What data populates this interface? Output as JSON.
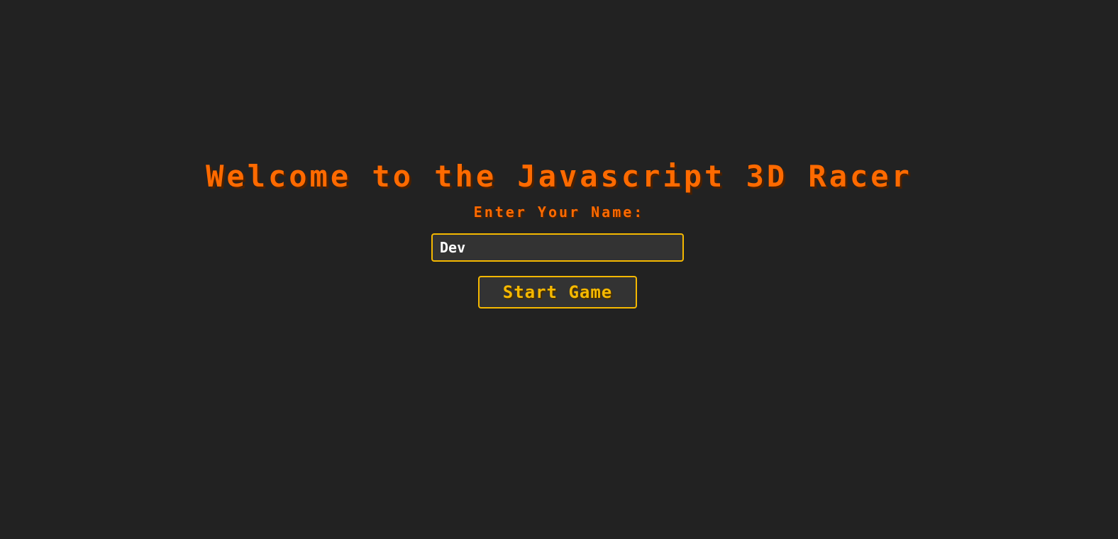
{
  "welcome": {
    "title": "Welcome to the Javascript 3D Racer",
    "name_label": "Enter Your Name:",
    "name_input_value": "Dev",
    "start_button_label": "Start Game"
  },
  "colors": {
    "background": "#222222",
    "title_orange": "#ff6a00",
    "accent_yellow": "#f5b800",
    "input_background": "#333333",
    "input_text": "#ffffff"
  }
}
